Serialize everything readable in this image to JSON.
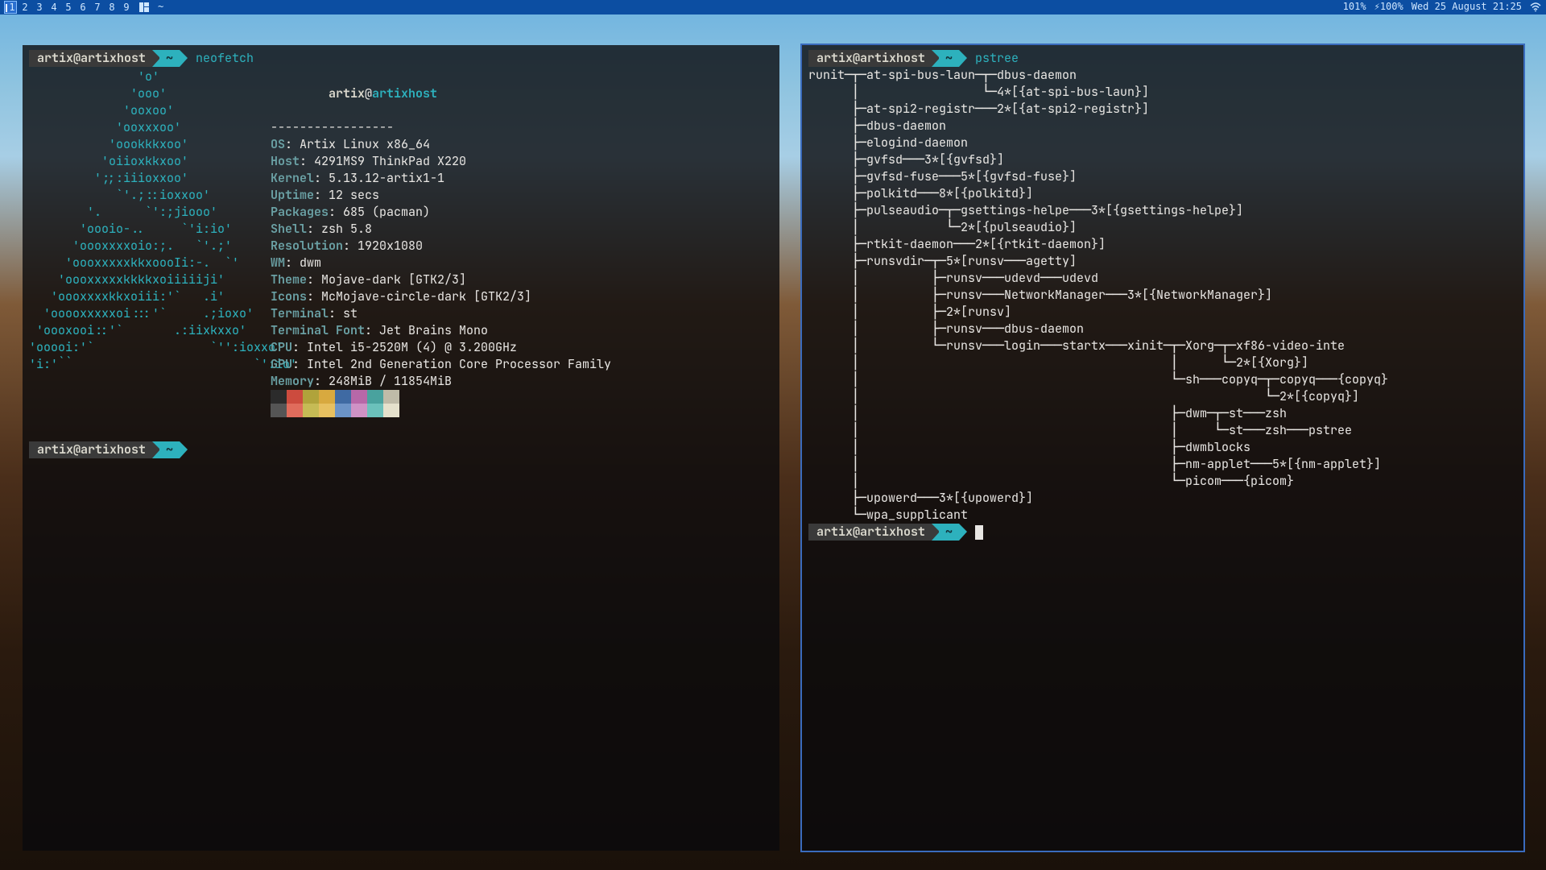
{
  "bar": {
    "workspaces": [
      "1",
      "2",
      "3",
      "4",
      "5",
      "6",
      "7",
      "8",
      "9"
    ],
    "active_workspace": 0,
    "title": "~",
    "status": {
      "battery1": "101%",
      "battery2_prefix": "⚡",
      "battery2": "100%",
      "datetime": "Wed 25 August 21:25"
    }
  },
  "prompt": {
    "userhost": "artix@artixhost",
    "dir": "~"
  },
  "left": {
    "command": "neofetch",
    "logo": [
      "               'o'",
      "              'ooo'",
      "             'ooxoo'",
      "            'ooxxxoo'",
      "           'oookkkxoo'",
      "          'oiioxkkxoo'",
      "         ';;:iiioxxoo'",
      "            `'.;::ioxxoo'",
      "        '.      `':;jiooo'",
      "       'oooio-..     `'i:io'",
      "      'oooxxxxoio:;.   `'.;'",
      "     'oooxxxxxkkxoooIi:-.  `'",
      "    'oooxxxxxkkkkxoiiiiiji'",
      "   'oooxxxxkkxoiii:'`   .i'",
      "  'ooooxxxxxoi:::'`     .;ioxo'",
      " 'oooxooi::'`       .:iixkxxo'",
      "'ooooi:'`                `'':ioxxo'",
      "'i:'``                         `':io'"
    ],
    "user": "artix",
    "host": "artixhost",
    "hr": "-----------------",
    "info": [
      {
        "k": "OS",
        "v": "Artix Linux x86_64"
      },
      {
        "k": "Host",
        "v": "4291MS9 ThinkPad X220"
      },
      {
        "k": "Kernel",
        "v": "5.13.12-artix1-1"
      },
      {
        "k": "Uptime",
        "v": "12 secs"
      },
      {
        "k": "Packages",
        "v": "685 (pacman)"
      },
      {
        "k": "Shell",
        "v": "zsh 5.8"
      },
      {
        "k": "Resolution",
        "v": "1920x1080"
      },
      {
        "k": "WM",
        "v": "dwm"
      },
      {
        "k": "Theme",
        "v": "Mojave-dark [GTK2/3]"
      },
      {
        "k": "Icons",
        "v": "McMojave-circle-dark [GTK2/3]"
      },
      {
        "k": "Terminal",
        "v": "st"
      },
      {
        "k": "Terminal Font",
        "v": "Jet Brains Mono"
      },
      {
        "k": "CPU",
        "v": "Intel i5-2520M (4) @ 3.200GHz"
      },
      {
        "k": "GPU",
        "v": "Intel 2nd Generation Core Processor Family"
      },
      {
        "k": "Memory",
        "v": "248MiB / 11854MiB"
      }
    ],
    "palette_top": [
      "#2b2b2b",
      "#cc4b3e",
      "#b0a33b",
      "#d8a93f",
      "#3f6aa3",
      "#b768a8",
      "#49a29e",
      "#bfbba8"
    ],
    "palette_bot": [
      "#555555",
      "#e06c5c",
      "#c6bb55",
      "#e7c060",
      "#6b93c7",
      "#cf92c5",
      "#6bc1bb",
      "#e5e1cc"
    ]
  },
  "right": {
    "command": "pstree",
    "tree": [
      "runit─┬─at-spi-bus-laun─┬─dbus-daemon",
      "      │                 └─4*[{at-spi-bus-laun}]",
      "      ├─at-spi2-registr───2*[{at-spi2-registr}]",
      "      ├─dbus-daemon",
      "      ├─elogind-daemon",
      "      ├─gvfsd───3*[{gvfsd}]",
      "      ├─gvfsd-fuse───5*[{gvfsd-fuse}]",
      "      ├─polkitd───8*[{polkitd}]",
      "      ├─pulseaudio─┬─gsettings-helpe───3*[{gsettings-helpe}]",
      "      │            └─2*[{pulseaudio}]",
      "      ├─rtkit-daemon───2*[{rtkit-daemon}]",
      "      ├─runsvdir─┬─5*[runsv───agetty]",
      "      │          ├─runsv───udevd───udevd",
      "      │          ├─runsv───NetworkManager───3*[{NetworkManager}]",
      "      │          ├─2*[runsv]",
      "      │          ├─runsv───dbus-daemon",
      "      │          └─runsv───login───startx───xinit─┬─Xorg─┬─xf86-video-inte",
      "      │                                           │      └─2*[{Xorg}]",
      "      │                                           └─sh───copyq─┬─copyq───{copyq}",
      "      │                                                        └─2*[{copyq}]",
      "      │                                           ├─dwm─┬─st───zsh",
      "      │                                           │     └─st───zsh───pstree",
      "      │                                           ├─dwmblocks",
      "      │                                           ├─nm-applet───5*[{nm-applet}]",
      "      │                                           └─picom───{picom}",
      "      ├─upowerd───3*[{upowerd}]",
      "      └─wpa_supplicant"
    ]
  }
}
